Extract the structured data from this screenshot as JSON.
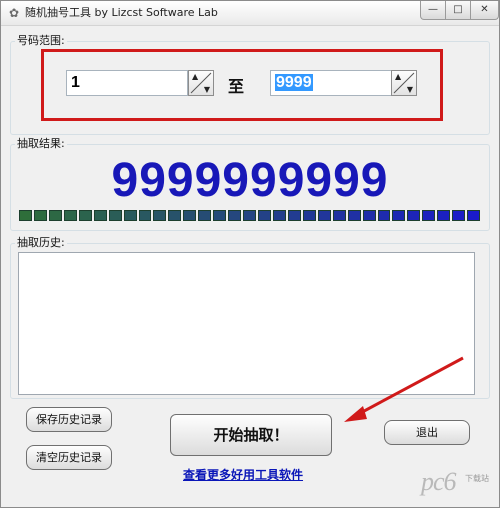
{
  "window": {
    "title": "随机抽号工具   by Lizcst Software Lab",
    "app_icon": "shell-app-icon",
    "controls": {
      "minimize": "—",
      "maximize": "□",
      "close": "✕"
    }
  },
  "range": {
    "label": "号码范围:",
    "from_value": "1",
    "to_label": "至",
    "to_value": "9999"
  },
  "result": {
    "label": "抽取结果:",
    "number": "9999999999",
    "progress_segments": 31,
    "progress_colors": [
      "#2e6e3a",
      "#1a1acb"
    ]
  },
  "history": {
    "label": "抽取历史:",
    "content": ""
  },
  "buttons": {
    "save_history": "保存历史记录",
    "clear_history": "清空历史记录",
    "start": "开始抽取！",
    "exit": "退出"
  },
  "link": "查看更多好用工具软件",
  "watermark": {
    "text": "pc6",
    "sub": "下载站"
  },
  "annotation": {
    "color": "#d01a1a"
  }
}
